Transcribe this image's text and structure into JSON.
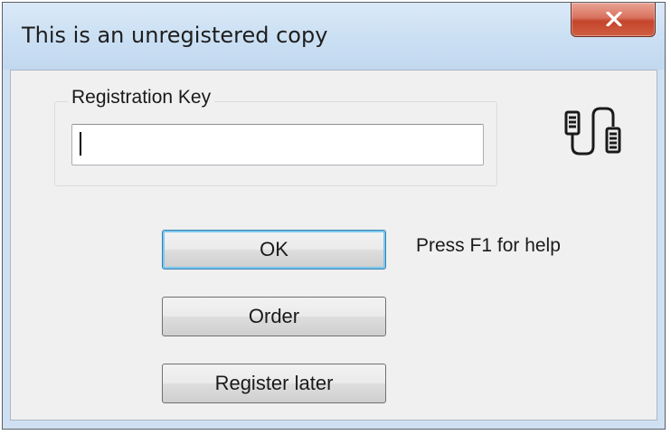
{
  "window": {
    "title": "This is an unregistered copy",
    "close_icon": "close-x-icon"
  },
  "registration": {
    "group_label": "Registration Key",
    "key_value": "",
    "key_placeholder": "",
    "icon": "cable-connector-icon"
  },
  "buttons": {
    "ok": "OK",
    "order": "Order",
    "register_later": "Register later"
  },
  "help": {
    "text": "Press F1 for help"
  },
  "colors": {
    "close_button": "#c4452b",
    "default_button_focus": "#3c7fb1",
    "client_background": "#f0f0f0"
  }
}
